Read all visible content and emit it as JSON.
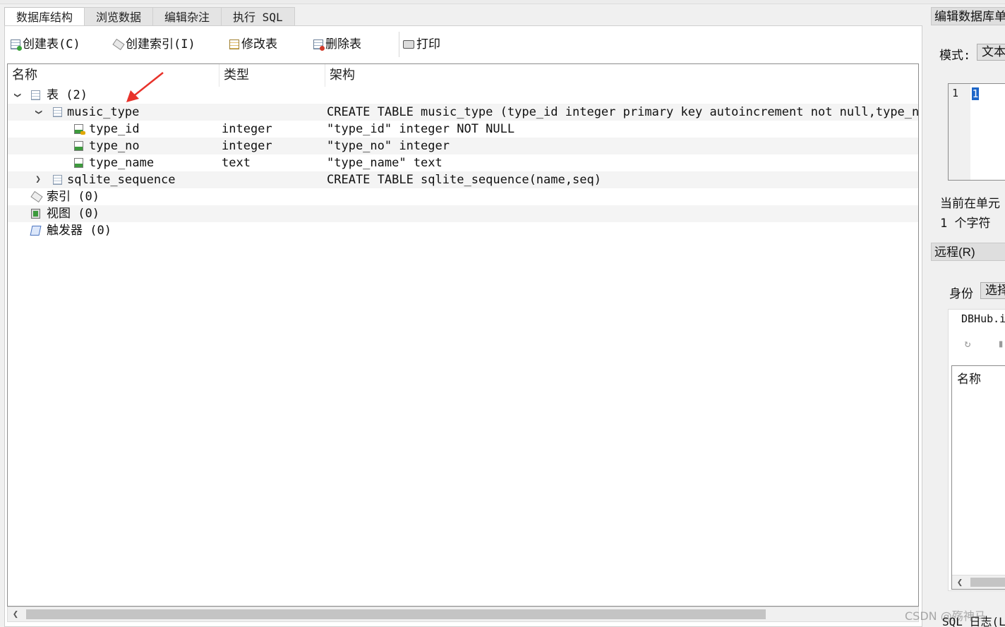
{
  "tabs": [
    {
      "label": "数据库结构",
      "active": true
    },
    {
      "label": "浏览数据",
      "active": false
    },
    {
      "label": "编辑杂注",
      "active": false
    },
    {
      "label": "执行 SQL",
      "active": false
    }
  ],
  "toolbar": {
    "create_table": "创建表(C)",
    "create_index": "创建索引(I)",
    "modify_table": "修改表",
    "delete_table": "删除表",
    "print": "打印"
  },
  "tree": {
    "columns": {
      "name": "名称",
      "type": "类型",
      "schema": "架构"
    },
    "rows": [
      {
        "name": "表 (2)",
        "type": "",
        "schema": ""
      },
      {
        "name": "music_type",
        "type": "",
        "schema": "CREATE TABLE music_type (type_id integer primary key autoincrement not null,type_no"
      },
      {
        "name": "type_id",
        "type": "integer",
        "schema": "\"type_id\" integer NOT NULL"
      },
      {
        "name": "type_no",
        "type": "integer",
        "schema": "\"type_no\" integer"
      },
      {
        "name": "type_name",
        "type": "text",
        "schema": "\"type_name\" text"
      },
      {
        "name": "sqlite_sequence",
        "type": "",
        "schema": "CREATE TABLE sqlite_sequence(name,seq)"
      },
      {
        "name": "索引 (0)",
        "type": "",
        "schema": ""
      },
      {
        "name": "视图 (0)",
        "type": "",
        "schema": ""
      },
      {
        "name": "触发器 (0)",
        "type": "",
        "schema": ""
      }
    ]
  },
  "right_panel": {
    "edit_cell_title": "编辑数据库单",
    "mode_label": "模式:",
    "mode_value": "文本",
    "line_number": "1",
    "cell_value": "1",
    "current_cell_text": "当前在单元",
    "char_count": "1 个字符",
    "remote_title": "远程(R)",
    "identity_label": "身份",
    "identity_value": "选择",
    "dbhub": "DBHub.i",
    "name_header": "名称",
    "sql_log_title": "SQL 日志(L"
  },
  "watermark": "CSDN @殇神马",
  "colors": {
    "selection": "#1e66c8",
    "arrow": "#e8322a"
  }
}
